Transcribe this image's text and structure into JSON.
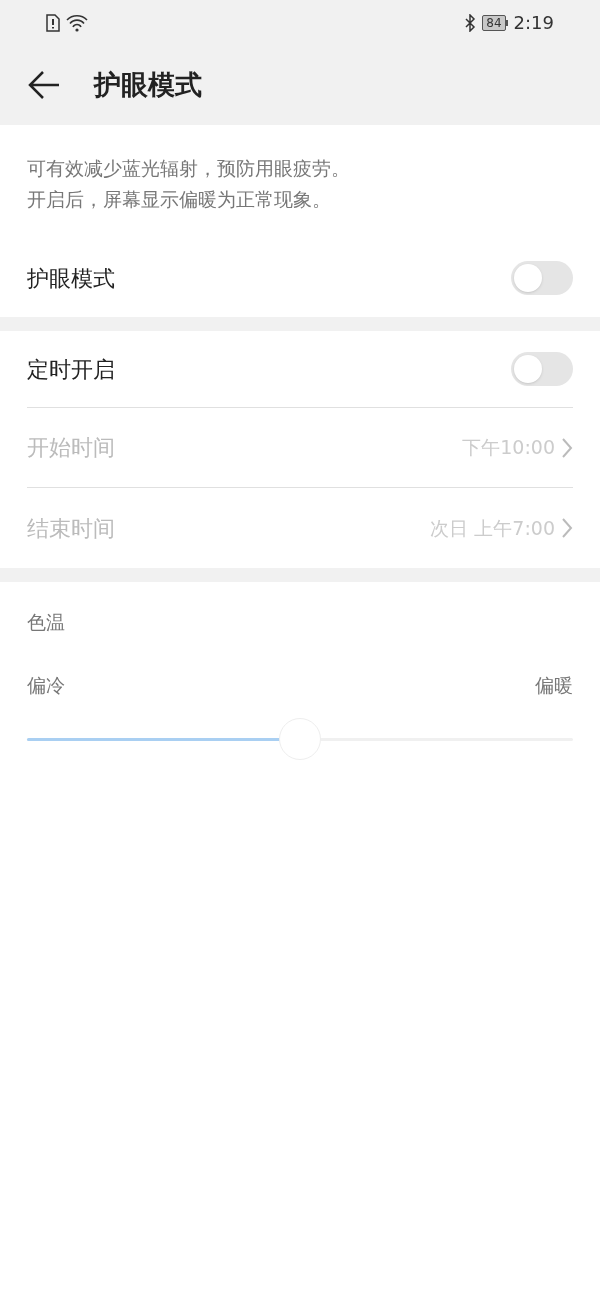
{
  "status_bar": {
    "battery": "84",
    "time": "2:19"
  },
  "header": {
    "title": "护眼模式"
  },
  "description": [
    "可有效减少蓝光辐射，预防用眼疲劳。",
    "开启后，屏幕显示偏暖为正常现象。"
  ],
  "eye_mode": {
    "label": "护眼模式",
    "on": false
  },
  "schedule": {
    "label": "定时开启",
    "on": false,
    "rows": [
      {
        "label": "开始时间",
        "value": "下午10:00",
        "disabled": true
      },
      {
        "label": "结束时间",
        "value": "次日 上午7:00",
        "disabled": true
      }
    ]
  },
  "color_temperature": {
    "title": "色温",
    "min_label": "偏冷",
    "max_label": "偏暖",
    "level": 0.5
  }
}
